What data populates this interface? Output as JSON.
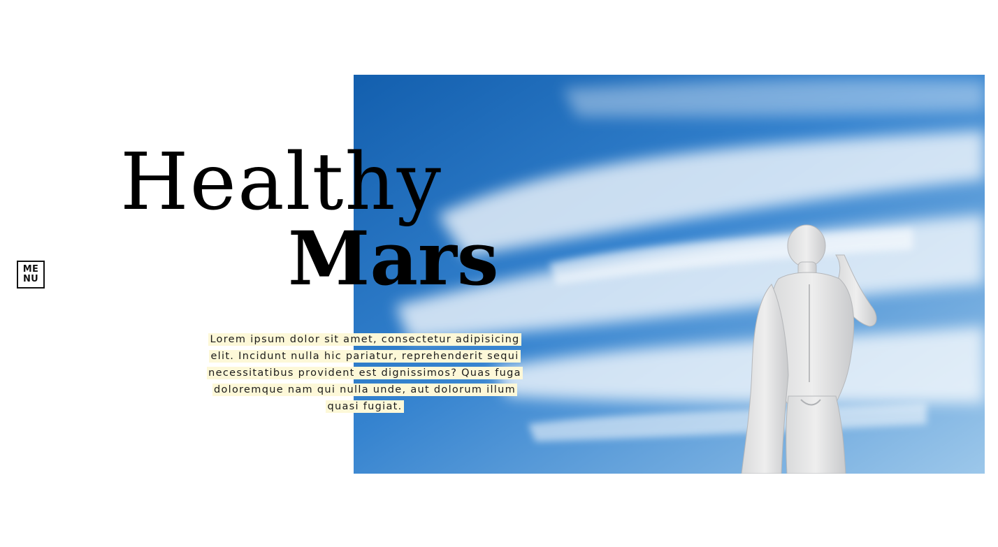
{
  "menu": {
    "line1": "ME",
    "line2": "NU"
  },
  "hero": {
    "title_line1": "Healthy",
    "title_line2": "Mars",
    "lede": "Lorem ipsum dolor sit amet, consectetur adipisicing elit. Incidunt nulla hic pariatur, reprehenderit sequi necessitatibus provident est dignissimos? Quas fuga doloremque nam qui nulla unde, aut dolorum illum quasi fugiat.",
    "image_subject": "statue-sky-image"
  },
  "colors": {
    "background": "#ffffff",
    "text": "#000000",
    "highlight": "#fdf8d8",
    "sky_top": "#1a64b0",
    "sky_bottom": "#8fbfe6"
  }
}
